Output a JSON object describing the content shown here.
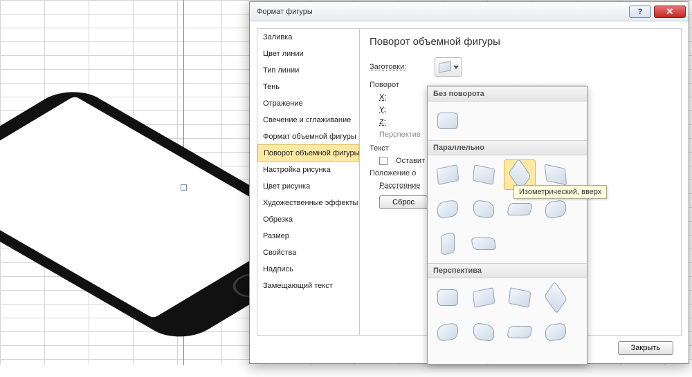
{
  "dialog": {
    "title": "Формат фигуры",
    "close_icon_char": "✕",
    "help_icon_char": "?",
    "nav": [
      "Заливка",
      "Цвет линии",
      "Тип линии",
      "Тень",
      "Отражение",
      "Свечение и сглаживание",
      "Формат объемной фигуры",
      "Поворот объемной фигуры",
      "Настройка рисунка",
      "Цвет рисунка",
      "Художественные эффекты",
      "Обрезка",
      "Размер",
      "Свойства",
      "Надпись",
      "Замещающий текст"
    ],
    "nav_selected_index": 7,
    "panel": {
      "heading": "Поворот объемной фигуры",
      "presets_label": "Заготовки:",
      "rotation_label": "Поворот",
      "axis_x": "X:",
      "axis_y": "Y:",
      "axis_z": "Z:",
      "perspective_label": "Перспектив",
      "text_label": "Текст",
      "keep_flat_label": "Оставит",
      "position_label": "Положение о",
      "distance_label": "Расстояние",
      "reset_label": "Сброс"
    },
    "close_button": "Закрыть"
  },
  "gallery": {
    "section_no_rotation": "Без поворота",
    "section_parallel": "Параллельно",
    "section_perspective": "Перспектива",
    "tooltip": "Изометрический, вверх"
  }
}
